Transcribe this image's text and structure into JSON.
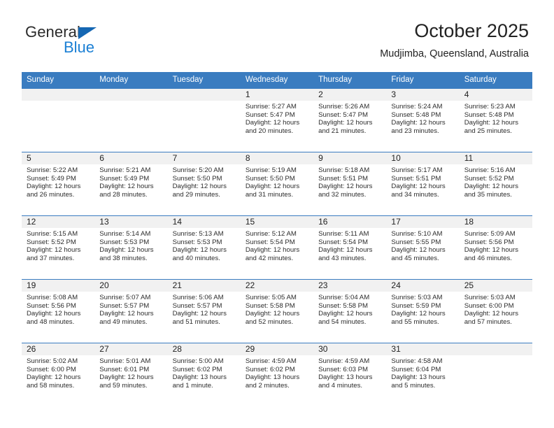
{
  "brand": {
    "word1": "General",
    "word2": "Blue",
    "triangle_color": "#1567b3",
    "blue_color": "#1a7fd4"
  },
  "header": {
    "title": "October 2025",
    "subtitle": "Mudjimba, Queensland, Australia"
  },
  "theme": {
    "header_row_bg": "#3a7cc0",
    "header_row_text": "#ffffff",
    "daynum_band_bg": "#f1f1f1",
    "row_border": "#3a7cc0",
    "cell_bg": "#ffffff",
    "body_text": "#2c2c2c"
  },
  "weekday_headers": [
    "Sunday",
    "Monday",
    "Tuesday",
    "Wednesday",
    "Thursday",
    "Friday",
    "Saturday"
  ],
  "weeks": [
    [
      {
        "day": "",
        "lines": []
      },
      {
        "day": "",
        "lines": []
      },
      {
        "day": "",
        "lines": []
      },
      {
        "day": "1",
        "lines": [
          "Sunrise: 5:27 AM",
          "Sunset: 5:47 PM",
          "Daylight: 12 hours",
          "and 20 minutes."
        ]
      },
      {
        "day": "2",
        "lines": [
          "Sunrise: 5:26 AM",
          "Sunset: 5:47 PM",
          "Daylight: 12 hours",
          "and 21 minutes."
        ]
      },
      {
        "day": "3",
        "lines": [
          "Sunrise: 5:24 AM",
          "Sunset: 5:48 PM",
          "Daylight: 12 hours",
          "and 23 minutes."
        ]
      },
      {
        "day": "4",
        "lines": [
          "Sunrise: 5:23 AM",
          "Sunset: 5:48 PM",
          "Daylight: 12 hours",
          "and 25 minutes."
        ]
      }
    ],
    [
      {
        "day": "5",
        "lines": [
          "Sunrise: 5:22 AM",
          "Sunset: 5:49 PM",
          "Daylight: 12 hours",
          "and 26 minutes."
        ]
      },
      {
        "day": "6",
        "lines": [
          "Sunrise: 5:21 AM",
          "Sunset: 5:49 PM",
          "Daylight: 12 hours",
          "and 28 minutes."
        ]
      },
      {
        "day": "7",
        "lines": [
          "Sunrise: 5:20 AM",
          "Sunset: 5:50 PM",
          "Daylight: 12 hours",
          "and 29 minutes."
        ]
      },
      {
        "day": "8",
        "lines": [
          "Sunrise: 5:19 AM",
          "Sunset: 5:50 PM",
          "Daylight: 12 hours",
          "and 31 minutes."
        ]
      },
      {
        "day": "9",
        "lines": [
          "Sunrise: 5:18 AM",
          "Sunset: 5:51 PM",
          "Daylight: 12 hours",
          "and 32 minutes."
        ]
      },
      {
        "day": "10",
        "lines": [
          "Sunrise: 5:17 AM",
          "Sunset: 5:51 PM",
          "Daylight: 12 hours",
          "and 34 minutes."
        ]
      },
      {
        "day": "11",
        "lines": [
          "Sunrise: 5:16 AM",
          "Sunset: 5:52 PM",
          "Daylight: 12 hours",
          "and 35 minutes."
        ]
      }
    ],
    [
      {
        "day": "12",
        "lines": [
          "Sunrise: 5:15 AM",
          "Sunset: 5:52 PM",
          "Daylight: 12 hours",
          "and 37 minutes."
        ]
      },
      {
        "day": "13",
        "lines": [
          "Sunrise: 5:14 AM",
          "Sunset: 5:53 PM",
          "Daylight: 12 hours",
          "and 38 minutes."
        ]
      },
      {
        "day": "14",
        "lines": [
          "Sunrise: 5:13 AM",
          "Sunset: 5:53 PM",
          "Daylight: 12 hours",
          "and 40 minutes."
        ]
      },
      {
        "day": "15",
        "lines": [
          "Sunrise: 5:12 AM",
          "Sunset: 5:54 PM",
          "Daylight: 12 hours",
          "and 42 minutes."
        ]
      },
      {
        "day": "16",
        "lines": [
          "Sunrise: 5:11 AM",
          "Sunset: 5:54 PM",
          "Daylight: 12 hours",
          "and 43 minutes."
        ]
      },
      {
        "day": "17",
        "lines": [
          "Sunrise: 5:10 AM",
          "Sunset: 5:55 PM",
          "Daylight: 12 hours",
          "and 45 minutes."
        ]
      },
      {
        "day": "18",
        "lines": [
          "Sunrise: 5:09 AM",
          "Sunset: 5:56 PM",
          "Daylight: 12 hours",
          "and 46 minutes."
        ]
      }
    ],
    [
      {
        "day": "19",
        "lines": [
          "Sunrise: 5:08 AM",
          "Sunset: 5:56 PM",
          "Daylight: 12 hours",
          "and 48 minutes."
        ]
      },
      {
        "day": "20",
        "lines": [
          "Sunrise: 5:07 AM",
          "Sunset: 5:57 PM",
          "Daylight: 12 hours",
          "and 49 minutes."
        ]
      },
      {
        "day": "21",
        "lines": [
          "Sunrise: 5:06 AM",
          "Sunset: 5:57 PM",
          "Daylight: 12 hours",
          "and 51 minutes."
        ]
      },
      {
        "day": "22",
        "lines": [
          "Sunrise: 5:05 AM",
          "Sunset: 5:58 PM",
          "Daylight: 12 hours",
          "and 52 minutes."
        ]
      },
      {
        "day": "23",
        "lines": [
          "Sunrise: 5:04 AM",
          "Sunset: 5:58 PM",
          "Daylight: 12 hours",
          "and 54 minutes."
        ]
      },
      {
        "day": "24",
        "lines": [
          "Sunrise: 5:03 AM",
          "Sunset: 5:59 PM",
          "Daylight: 12 hours",
          "and 55 minutes."
        ]
      },
      {
        "day": "25",
        "lines": [
          "Sunrise: 5:03 AM",
          "Sunset: 6:00 PM",
          "Daylight: 12 hours",
          "and 57 minutes."
        ]
      }
    ],
    [
      {
        "day": "26",
        "lines": [
          "Sunrise: 5:02 AM",
          "Sunset: 6:00 PM",
          "Daylight: 12 hours",
          "and 58 minutes."
        ]
      },
      {
        "day": "27",
        "lines": [
          "Sunrise: 5:01 AM",
          "Sunset: 6:01 PM",
          "Daylight: 12 hours",
          "and 59 minutes."
        ]
      },
      {
        "day": "28",
        "lines": [
          "Sunrise: 5:00 AM",
          "Sunset: 6:02 PM",
          "Daylight: 13 hours",
          "and 1 minute."
        ]
      },
      {
        "day": "29",
        "lines": [
          "Sunrise: 4:59 AM",
          "Sunset: 6:02 PM",
          "Daylight: 13 hours",
          "and 2 minutes."
        ]
      },
      {
        "day": "30",
        "lines": [
          "Sunrise: 4:59 AM",
          "Sunset: 6:03 PM",
          "Daylight: 13 hours",
          "and 4 minutes."
        ]
      },
      {
        "day": "31",
        "lines": [
          "Sunrise: 4:58 AM",
          "Sunset: 6:04 PM",
          "Daylight: 13 hours",
          "and 5 minutes."
        ]
      },
      {
        "day": "",
        "lines": []
      }
    ]
  ]
}
